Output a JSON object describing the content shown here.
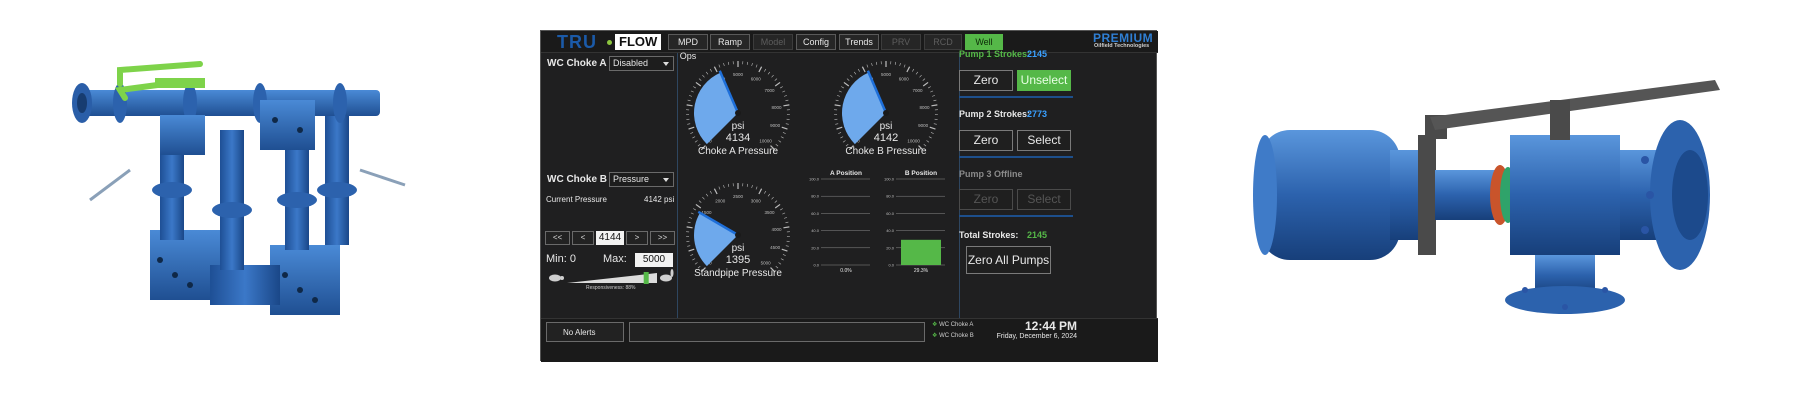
{
  "colors": {
    "equipment_blue": "#2f64a8",
    "handle_green": "#7ed34a",
    "panel_bg": "#1f1f20",
    "accent_green": "#55b848",
    "gauge_fill": "#6ea9ec",
    "needle_blue": "#1e6fd9",
    "stroke_count_blue": "#3aa0ff",
    "total_green": "#55b848"
  },
  "hmi": {
    "logo": {
      "part1": "TRU",
      "part2": "FLOW"
    },
    "brand": {
      "name": "PREMIUM",
      "sub": "Oilfield Technologies"
    },
    "tabs": [
      {
        "label": "MPD Ops",
        "state": "normal"
      },
      {
        "label": "Ramp",
        "state": "normal"
      },
      {
        "label": "Model",
        "state": "disabled"
      },
      {
        "label": "Config",
        "state": "normal"
      },
      {
        "label": "Trends",
        "state": "normal"
      },
      {
        "label": "PRV",
        "state": "disabled"
      },
      {
        "label": "RCD",
        "state": "disabled"
      },
      {
        "label": "Well Control",
        "state": "active"
      }
    ],
    "choke_a": {
      "label": "WC Choke A",
      "mode": "Disabled"
    },
    "choke_b": {
      "label": "WC Choke B",
      "mode": "Pressure"
    },
    "current_pressure": {
      "label": "Current Pressure",
      "value": "4142 psi"
    },
    "stepper": {
      "btn1": "<<",
      "btn2": "<",
      "value": "4144",
      "btn3": ">",
      "btn4": ">>"
    },
    "limits": {
      "min_label": "Min: 0",
      "max_label": "Max:",
      "max_value": "5000"
    },
    "responsiveness": {
      "label": "Responsiveness: 88%",
      "fraction": 0.88
    },
    "gauges": [
      {
        "unit": "psi",
        "value": "4134",
        "title": "Choke A Pressure",
        "reading": 4134,
        "max": 10000,
        "ticks": [
          "0",
          "1000",
          "2000",
          "3000",
          "4000",
          "5000",
          "6000",
          "7000",
          "8000",
          "9000",
          "10000"
        ]
      },
      {
        "unit": "psi",
        "value": "4142",
        "title": "Choke B Pressure",
        "reading": 4142,
        "max": 10000,
        "ticks": [
          "0",
          "1000",
          "2000",
          "3000",
          "4000",
          "5000",
          "6000",
          "7000",
          "8000",
          "9000",
          "10000"
        ]
      },
      {
        "unit": "psi",
        "value": "1395",
        "title": "Standpipe Pressure",
        "reading": 1395,
        "max": 5000,
        "ticks": [
          "0",
          "500",
          "1000",
          "1500",
          "2000",
          "2500",
          "3000",
          "3500",
          "4000",
          "4500",
          "5000"
        ]
      }
    ],
    "positions": [
      {
        "title": "A Position",
        "reading": 0.0,
        "value_label": "0.0%",
        "ticks": [
          "100.0",
          "80.0",
          "60.0",
          "40.0",
          "20.0",
          "0.0"
        ]
      },
      {
        "title": "B Position",
        "reading": 29.3,
        "value_label": "29.3%",
        "ticks": [
          "100.0",
          "80.0",
          "60.0",
          "40.0",
          "20.0",
          "0.0"
        ]
      }
    ],
    "pumps": {
      "pump1": {
        "label": "Pump 1 Strokes:",
        "value": "2145",
        "zero": "Zero",
        "select": "Unselect"
      },
      "pump2": {
        "label": "Pump 2 Strokes:",
        "value": "2773",
        "zero": "Zero",
        "select": "Select"
      },
      "pump3": {
        "label": "Pump 3 Offline",
        "zero": "Zero",
        "select": "Select"
      },
      "total": {
        "label": "Total Strokes:",
        "value": "2145"
      },
      "zero_all": "Zero All Pumps"
    },
    "footer": {
      "alerts": "No Alerts",
      "status": [
        "WC Choke A",
        "WC Choke B"
      ],
      "time": "12:44 PM",
      "date": "Friday, December 6, 2024"
    }
  }
}
